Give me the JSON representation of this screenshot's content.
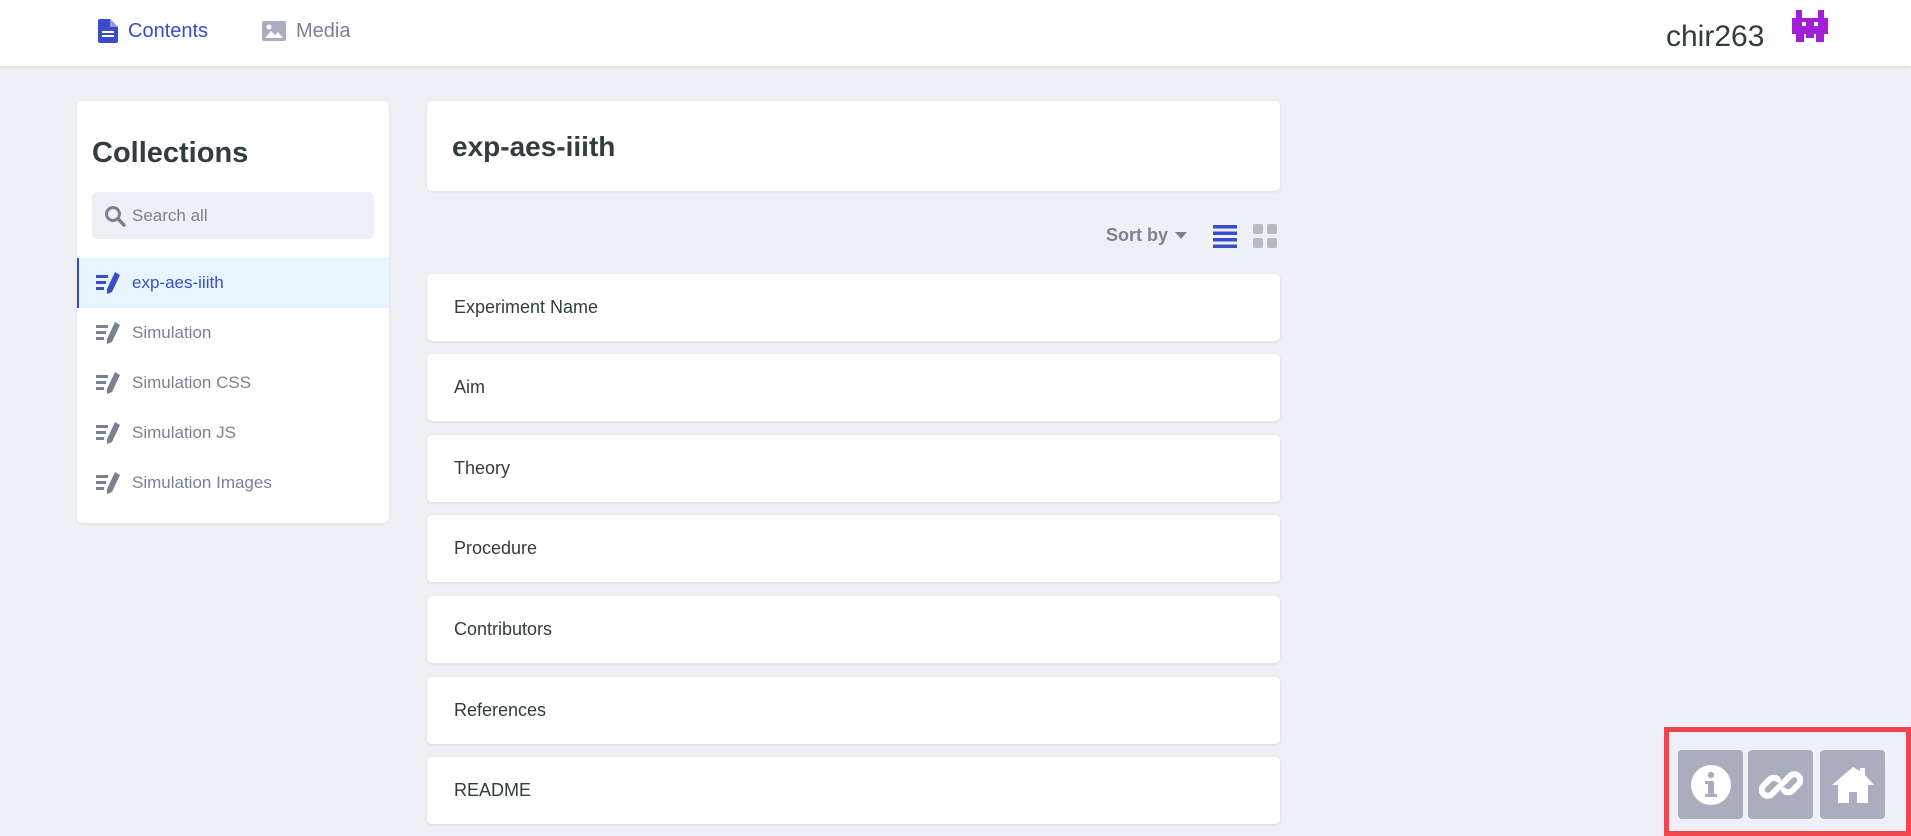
{
  "topbar": {
    "nav": [
      {
        "label": "Contents",
        "icon": "document-icon",
        "active": true
      },
      {
        "label": "Media",
        "icon": "image-icon",
        "active": false
      }
    ],
    "username": "chir263",
    "avatar_color": "#a31fd7"
  },
  "sidebar": {
    "title": "Collections",
    "search_placeholder": "Search all",
    "items": [
      {
        "label": "exp-aes-iiith",
        "active": true
      },
      {
        "label": "Simulation",
        "active": false
      },
      {
        "label": "Simulation CSS",
        "active": false
      },
      {
        "label": "Simulation JS",
        "active": false
      },
      {
        "label": "Simulation Images",
        "active": false
      }
    ]
  },
  "main": {
    "title": "exp-aes-iiith",
    "sort_label": "Sort by",
    "entries": [
      "Experiment Name",
      "Aim",
      "Theory",
      "Procedure",
      "Contributors",
      "References",
      "README"
    ]
  },
  "actions": [
    {
      "icon": "info-icon"
    },
    {
      "icon": "link-icon"
    },
    {
      "icon": "home-icon"
    }
  ],
  "colors": {
    "accent": "#3a4cc7",
    "muted": "#798291",
    "highlight_border": "#f0454c",
    "action_button": "#a9adbd"
  }
}
